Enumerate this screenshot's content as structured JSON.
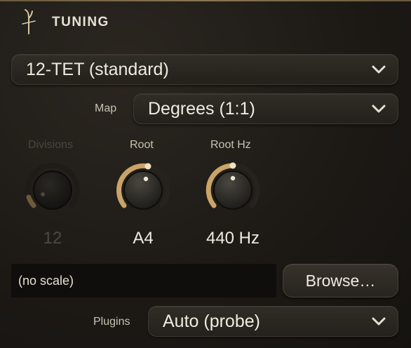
{
  "panel": {
    "title": "TUNING",
    "icon": "tuning-fork-icon"
  },
  "scale_select": {
    "value": "12-TET (standard)"
  },
  "map": {
    "label": "Map",
    "value": "Degrees (1:1)"
  },
  "knobs": {
    "divisions": {
      "label": "Divisions",
      "value": "12",
      "enabled": false
    },
    "root": {
      "label": "Root",
      "value": "A4",
      "enabled": true
    },
    "root_hz": {
      "label": "Root Hz",
      "value": "440 Hz",
      "enabled": true
    }
  },
  "scale_file": {
    "value": "(no scale)",
    "browse_label": "Browse…"
  },
  "plugins": {
    "label": "Plugins",
    "value": "Auto (probe)"
  },
  "colors": {
    "accent": "#c9a468",
    "background": "#1c1915"
  }
}
